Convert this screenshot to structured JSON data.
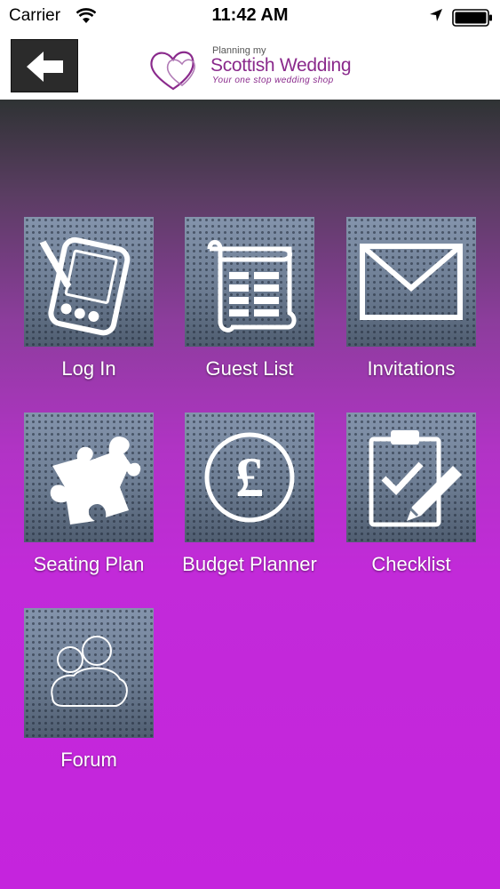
{
  "status_bar": {
    "carrier": "Carrier",
    "time": "11:42 AM"
  },
  "header": {
    "logo": {
      "line1": "Planning my",
      "line2": "Scottish Wedding",
      "line3": "Your one stop wedding shop"
    }
  },
  "menu": [
    {
      "label": "Log In",
      "icon": "pda-stylus-icon"
    },
    {
      "label": "Guest List",
      "icon": "scroll-list-icon"
    },
    {
      "label": "Invitations",
      "icon": "envelope-icon"
    },
    {
      "label": "Seating Plan",
      "icon": "puzzle-piece-icon"
    },
    {
      "label": "Budget Planner",
      "icon": "pound-coin-icon"
    },
    {
      "label": "Checklist",
      "icon": "clipboard-checklist-icon"
    },
    {
      "label": "Forum",
      "icon": "people-group-icon"
    }
  ],
  "colors": {
    "brand": "#8a2a8c",
    "background_top": "#2f3334",
    "background_bottom": "#c524dd",
    "tile": "#6c7c90"
  }
}
